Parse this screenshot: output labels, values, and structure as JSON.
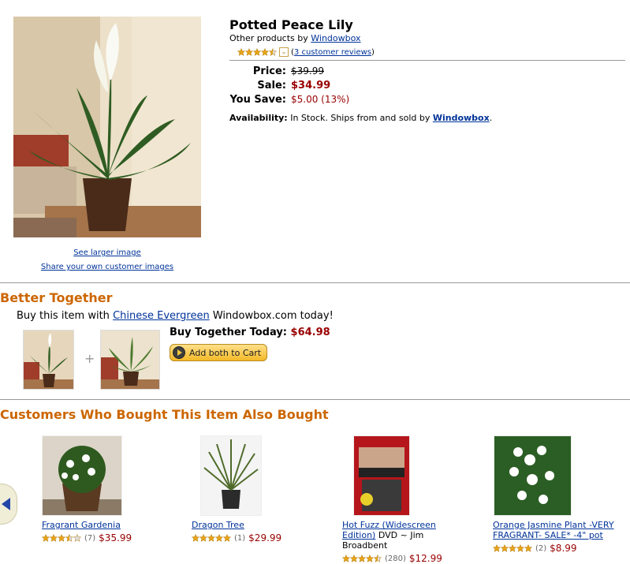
{
  "product": {
    "title": "Potted Peace Lily",
    "byline_prefix": "Other products by",
    "brand": "Windowbox",
    "rating": 4.5,
    "review_link": "3 customer reviews",
    "review_open": "(",
    "review_close": ")",
    "see_larger": "See larger image",
    "share_images": "Share your own customer images"
  },
  "pricing": {
    "price_label": "Price:",
    "price_value": "$39.99",
    "sale_label": "Sale:",
    "sale_value": "$34.99",
    "save_label": "You Save:",
    "save_value": "$5.00 (13%)"
  },
  "availability": {
    "label": "Availability:",
    "text": " In Stock. Ships from and sold by ",
    "seller": "Windowbox",
    "end": "."
  },
  "better_together": {
    "title": "Better Together",
    "prefix": "Buy this item with ",
    "item_link": "Chinese Evergreen",
    "suffix": " Windowbox.com today!",
    "today_label": "Buy Together Today:",
    "today_price": "$64.98",
    "plus": "+",
    "cart_button": "Add both to Cart"
  },
  "also_bought": {
    "title": "Customers Who Bought This Item Also Bought",
    "items": [
      {
        "name": "Fragrant Gardenia",
        "extra": "",
        "rating": 3.5,
        "count": "(7)",
        "price": "$35.99"
      },
      {
        "name": "Dragon Tree",
        "extra": "",
        "rating": 5,
        "count": "(1)",
        "price": "$29.99"
      },
      {
        "name": "Hot Fuzz (Widescreen Edition)",
        "extra": " DVD ~ Jim Broadbent",
        "rating": 4.5,
        "count": "(280)",
        "price": "$12.99"
      },
      {
        "name": "Orange Jasmine Plant -VERY FRAGRANT- SALE* -4\" pot",
        "extra": "",
        "rating": 5,
        "count": "(2)",
        "price": "$8.99"
      }
    ]
  },
  "colors": {
    "accent_orange": "#cc6600",
    "price_red": "#990000",
    "link_blue": "#003399",
    "star_gold": "#e8a317"
  },
  "icons": [
    "dropdown-icon",
    "cart-icon",
    "carousel-prev-icon",
    "star-icon"
  ]
}
